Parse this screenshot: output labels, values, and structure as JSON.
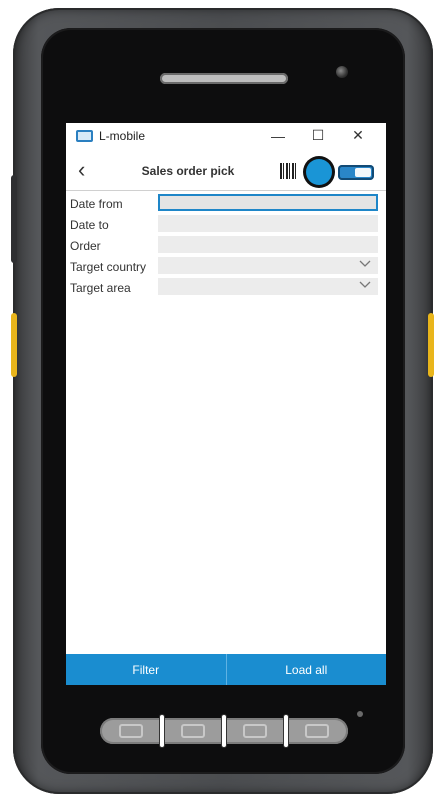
{
  "window": {
    "title": "L-mobile",
    "controls": {
      "minimize": "—",
      "maximize": "☐",
      "close": "✕"
    }
  },
  "header": {
    "back_icon": "‹",
    "title": "Sales order pick"
  },
  "form": {
    "fields": [
      {
        "label": "Date from",
        "value": "",
        "type": "text",
        "focused": true
      },
      {
        "label": "Date to",
        "value": "",
        "type": "text"
      },
      {
        "label": "Order",
        "value": "",
        "type": "text"
      },
      {
        "label": "Target country",
        "value": "",
        "type": "select"
      },
      {
        "label": "Target area",
        "value": "",
        "type": "select"
      }
    ]
  },
  "actions": {
    "filter_label": "Filter",
    "load_all_label": "Load all"
  },
  "colors": {
    "accent": "#1a8dd0",
    "field_bg": "#ececec",
    "focus_border": "#1e86c8"
  }
}
